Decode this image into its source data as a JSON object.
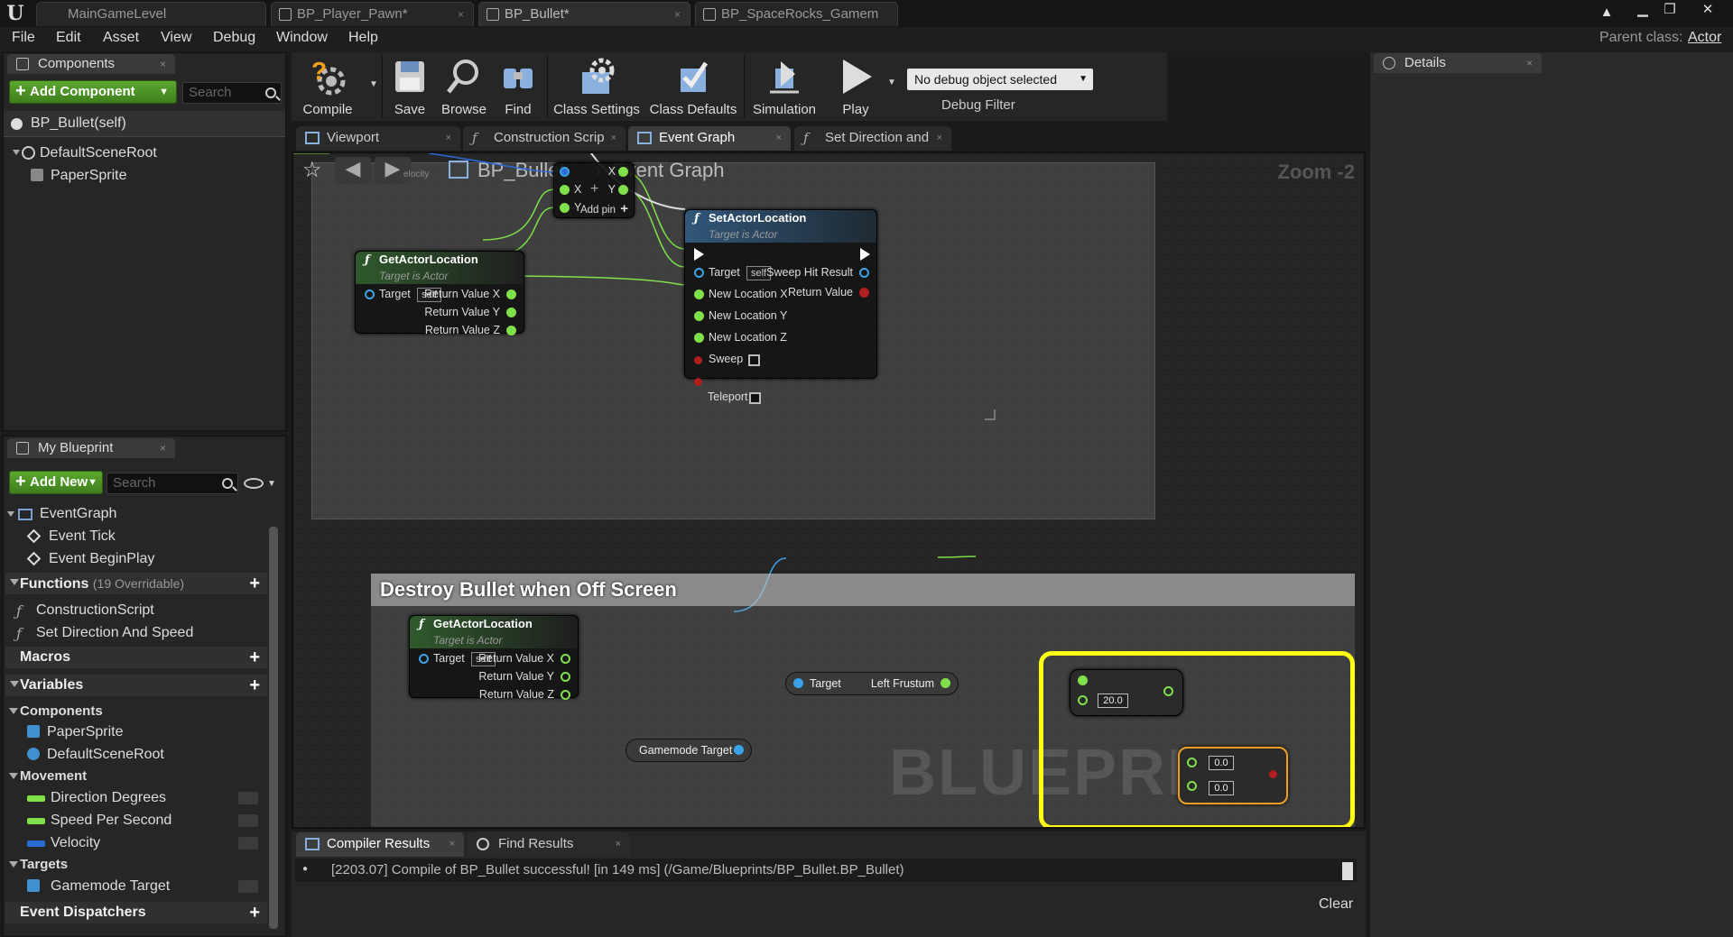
{
  "window": {
    "tabs": [
      {
        "label": "MainGameLevel"
      },
      {
        "label": "BP_Player_Pawn*"
      },
      {
        "label": "BP_Bullet*"
      },
      {
        "label": "BP_SpaceRocks_Gamem"
      }
    ]
  },
  "menu": [
    "File",
    "Edit",
    "Asset",
    "View",
    "Debug",
    "Window",
    "Help"
  ],
  "parent_class": {
    "label": "Parent class:",
    "value": "Actor"
  },
  "components": {
    "tab": "Components",
    "add_label": "Add Component",
    "search_placeholder": "Search",
    "self_item": "BP_Bullet(self)",
    "items": [
      "DefaultSceneRoot",
      "PaperSprite"
    ]
  },
  "toolbar": {
    "buttons": [
      "Compile",
      "Save",
      "Browse",
      "Find",
      "Class Settings",
      "Class Defaults",
      "Simulation",
      "Play"
    ],
    "debug_select": "No debug object selected",
    "debug_filter": "Debug Filter"
  },
  "graph_tabs": [
    "Viewport",
    "Construction Scrip",
    "Event Graph",
    "Set Direction and"
  ],
  "graph": {
    "breadcrumb_root": "BP_Bullet",
    "breadcrumb_leaf": "Event Graph",
    "zoom": "Zoom -2",
    "watermark": "BLUEPRINT",
    "comment_title": "Destroy Bullet when Off Screen",
    "nodes": {
      "get_actor_location": "GetActorLocation",
      "target_is_actor": "Target is Actor",
      "target": "Target",
      "self": "self",
      "rx": "Return Value X",
      "ry": "Return Value Y",
      "rz": "Return Value Z",
      "make_x": "X",
      "make_y": "Y",
      "out_x": "X",
      "out_y": "Y",
      "add_pin": "Add pin",
      "set_actor_location": "SetActorLocation",
      "sweep_hit": "Sweep Hit Result",
      "return_value": "Return Value",
      "nlx": "New Location X",
      "nly": "New Location Y",
      "nlz": "New Location Z",
      "sweep": "Sweep",
      "teleport": "Teleport",
      "left_frustum_target": "Target",
      "left_frustum": "Left Frustum",
      "gamemode_target": "Gamemode Target",
      "v20": "20.0",
      "v00a": "0.0",
      "v00b": "0.0",
      "velocity_ghost": "elocity"
    }
  },
  "my_blueprint": {
    "tab": "My Blueprint",
    "add_label": "Add New",
    "search_placeholder": "Search",
    "eventgraph": "EventGraph",
    "events": [
      "Event Tick",
      "Event BeginPlay"
    ],
    "functions_label": "Functions",
    "functions_note": "(19 Overridable)",
    "functions": [
      "ConstructionScript",
      "Set Direction And Speed"
    ],
    "macros_label": "Macros",
    "variables_label": "Variables",
    "categories": [
      {
        "name": "Components",
        "items": [
          "PaperSprite",
          "DefaultSceneRoot"
        ]
      },
      {
        "name": "Movement",
        "items": [
          "Direction Degrees",
          "Speed Per Second",
          "Velocity"
        ]
      },
      {
        "name": "Targets",
        "items": [
          "Gamemode Target"
        ]
      }
    ],
    "dispatchers_label": "Event Dispatchers"
  },
  "bottom": {
    "tabs": [
      "Compiler Results",
      "Find Results"
    ],
    "log": "[2203.07] Compile of BP_Bullet successful! [in 149 ms] (/Game/Blueprints/BP_Bullet.BP_Bullet)",
    "clear": "Clear"
  },
  "details": {
    "tab": "Details"
  },
  "colors": {
    "float": "#7fe04a",
    "object": "#3aa3e8",
    "bool": "#b01e1e",
    "highlight": "#ffff14",
    "add_green": "#4f9a25"
  }
}
